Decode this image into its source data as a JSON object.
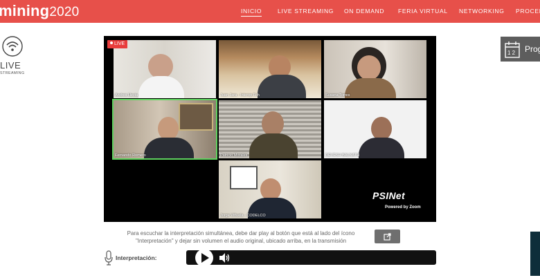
{
  "brand": {
    "name": "mining",
    "year": "2020"
  },
  "nav": {
    "items": [
      {
        "label": "INICIO",
        "active": true
      },
      {
        "label": "LIVE STREAMING",
        "active": false
      },
      {
        "label": "ON DEMAND",
        "active": false
      },
      {
        "label": "FERIA VIRTUAL",
        "active": false
      },
      {
        "label": "NETWORKING",
        "active": false
      },
      {
        "label": "PROCED",
        "active": false
      }
    ]
  },
  "side_logo": {
    "live": "LIVE",
    "streaming": "STREAMING",
    "icon": "wifi-icon"
  },
  "programa_button": {
    "label": "Prog",
    "icon": "calendar-icon",
    "calendar_text": "1 2"
  },
  "stream": {
    "live_badge": "LIVE",
    "participants": [
      {
        "name": "Andres Hevia",
        "speaking": false
      },
      {
        "name": "Juan Jara - Interop Fch",
        "speaking": false
      },
      {
        "name": "Susana Torres",
        "speaking": false
      },
      {
        "name": "Fernando Romero",
        "speaking": true
      },
      {
        "name": "Patricio Morales",
        "speaking": false
      },
      {
        "name": "DEVESH BALNATH",
        "speaking": false
      },
      {
        "name": "Jorge Viñuela - CODELCO",
        "speaking": false
      }
    ],
    "watermark": "PSINet",
    "powered_by": "Powered by Zoom"
  },
  "interpretation": {
    "instructions_line1": "Para escuchar la interpretación simultánea, debe dar play al botón que está al lado del ícono",
    "instructions_line2": "\"Interpretación\" y dejar sin volumen el audio original, ubicado arriba, en la transmisión",
    "label": "Interpretación:",
    "external_icon": "external-link-icon",
    "play_icon": "play-icon",
    "volume_icon": "volume-icon"
  },
  "colors": {
    "topbar": "#e7504a",
    "active_speaker": "#5fd35f",
    "live_badge": "#e83c3c"
  }
}
